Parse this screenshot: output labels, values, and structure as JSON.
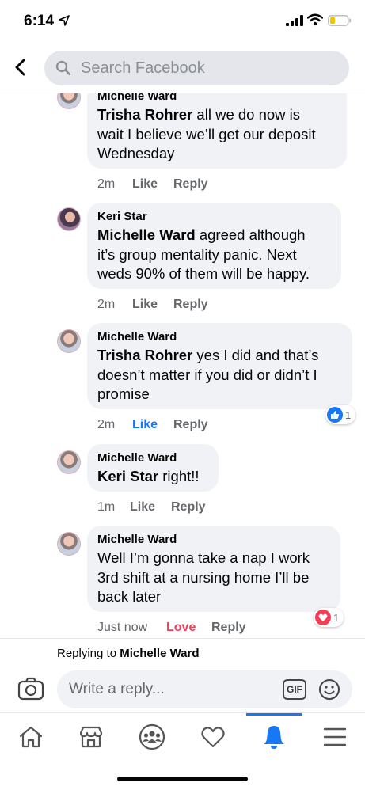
{
  "status_bar": {
    "time": "6:14"
  },
  "search": {
    "placeholder": "Search Facebook"
  },
  "comments": [
    {
      "author": "Michelle Ward",
      "mention": "Trisha Rohrer",
      "text_line1": " all we do now is",
      "text_line2": "wait I believe we’ll get our deposit",
      "text_line3": "Wednesday",
      "time": "2m",
      "like": "Like",
      "reply": "Reply"
    },
    {
      "author": "Keri Star",
      "mention": "Michelle Ward",
      "text_line1": " agreed although",
      "text_line2": "it’s group mentality panic.  Next",
      "text_line3": "weds 90% of them will be happy.",
      "time": "2m",
      "like": "Like",
      "reply": "Reply"
    },
    {
      "author": "Michelle Ward",
      "mention": "Trisha Rohrer",
      "text_line1": " yes I did and that’s",
      "text_line2": "doesn’t matter if you did or didn’t I",
      "text_line3": "promise",
      "time": "2m",
      "like": "Like",
      "reply": "Reply",
      "reaction_count": "1"
    },
    {
      "author": "Michelle Ward",
      "mention": "Keri Star",
      "text_line1": " right!!",
      "time": "1m",
      "like": "Like",
      "reply": "Reply"
    },
    {
      "author": "Michelle Ward",
      "text_line1": "Well I’m gonna take a nap I work",
      "text_line2": "3rd shift at a nursing home I’ll be",
      "text_line3": "back later",
      "time": "Just now",
      "like": "Love",
      "reply": "Reply",
      "reaction_count": "1"
    }
  ],
  "reply_bar": {
    "replying_prefix": "Replying to ",
    "replying_name": "Michelle Ward",
    "placeholder": "Write a reply...",
    "gif_label": "GIF"
  },
  "colors": {
    "accent": "#1877f2",
    "love": "#f33e58",
    "bubble": "#f0f2f5",
    "muted": "#65676b"
  },
  "tabs": [
    "home-icon",
    "marketplace-icon",
    "groups-icon",
    "dating-icon",
    "notifications-icon",
    "menu-icon"
  ]
}
